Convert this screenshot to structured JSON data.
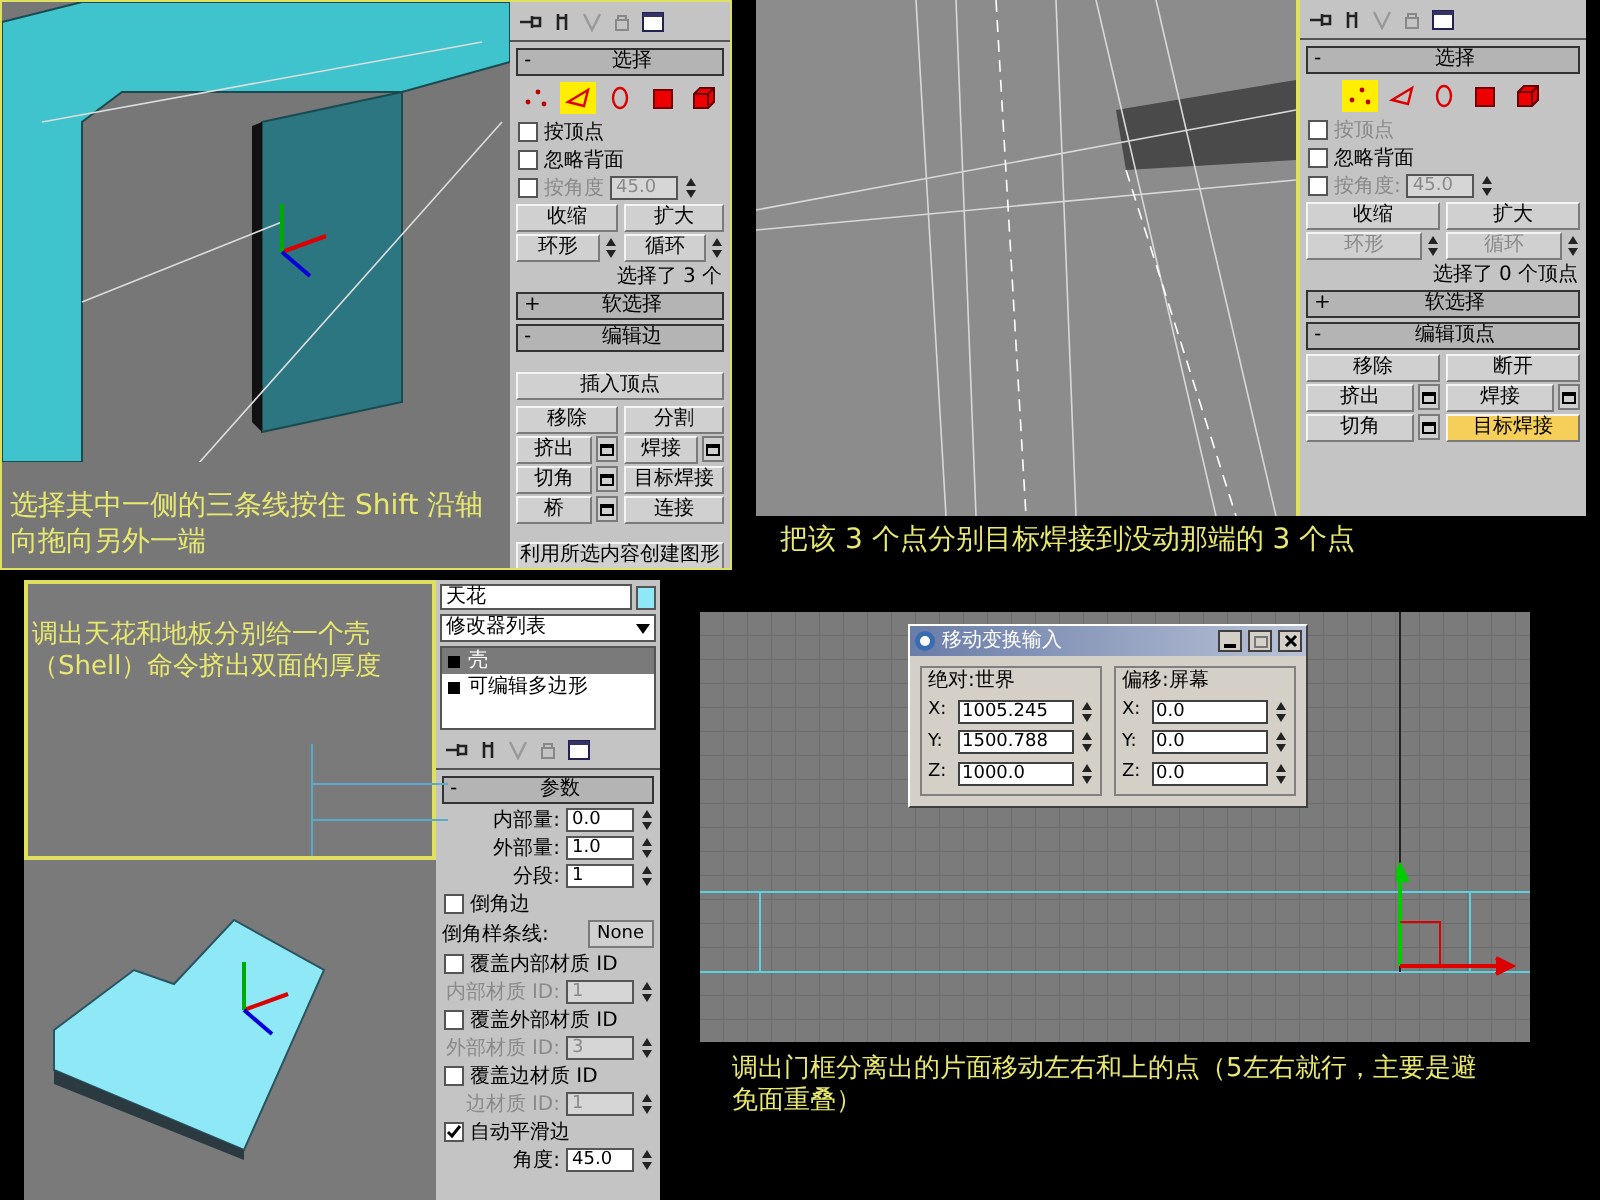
{
  "top_left": {
    "caption": "选择其中一侧的三条线按住 Shift 沿轴向拖向另外一端",
    "command_panel": {
      "rollouts": [
        {
          "toggle": "-",
          "title": "选择",
          "items": [
            {
              "kind": "modes",
              "modes": [
                {
                  "selected": false
                },
                {
                  "selected": true
                },
                {
                  "selected": false
                },
                {
                  "selected": false
                },
                {
                  "selected": false
                }
              ]
            },
            {
              "kind": "checkbox",
              "label": "按顶点",
              "checked": false,
              "disabled": false
            },
            {
              "kind": "checkbox",
              "label": "忽略背面",
              "checked": false,
              "disabled": false
            },
            {
              "kind": "angle",
              "label": "按角度",
              "value": "45.0",
              "checked": false,
              "disabled": true
            },
            {
              "kind": "buttons",
              "buttons": [
                {
                  "kind": "plain",
                  "label": "收缩",
                  "disabled": false,
                  "active": false
                },
                {
                  "kind": "plain",
                  "label": "扩大",
                  "disabled": false,
                  "active": false
                }
              ]
            },
            {
              "kind": "buttons",
              "buttons": [
                {
                  "kind": "spin",
                  "label": "环形",
                  "disabled": false,
                  "active": false
                },
                {
                  "kind": "spin",
                  "label": "循环",
                  "disabled": false,
                  "active": false
                }
              ]
            },
            {
              "kind": "status",
              "text": "选择了 3 个"
            }
          ]
        },
        {
          "toggle": "+",
          "title": "软选择"
        },
        {
          "toggle": "-",
          "title": "编辑边",
          "items": [
            {
              "kind": "wide",
              "label": "插入顶点"
            },
            {
              "kind": "buttons",
              "buttons": [
                {
                  "kind": "plain",
                  "label": "移除",
                  "disabled": false,
                  "active": false
                },
                {
                  "kind": "plain",
                  "label": "分割",
                  "disabled": false,
                  "active": false
                }
              ]
            },
            {
              "kind": "buttons",
              "buttons": [
                {
                  "kind": "settings",
                  "label": "挤出",
                  "disabled": false,
                  "active": false
                },
                {
                  "kind": "settings",
                  "label": "焊接",
                  "disabled": false,
                  "active": false
                }
              ]
            },
            {
              "kind": "buttons",
              "buttons": [
                {
                  "kind": "settings",
                  "label": "切角",
                  "disabled": false,
                  "active": false
                },
                {
                  "kind": "plain",
                  "label": "目标焊接",
                  "disabled": false,
                  "active": false
                }
              ]
            },
            {
              "kind": "buttons",
              "buttons": [
                {
                  "kind": "settings",
                  "label": "桥",
                  "disabled": false,
                  "active": false
                },
                {
                  "kind": "plain",
                  "label": "连接",
                  "disabled": false,
                  "active": false
                }
              ]
            },
            {
              "kind": "wide",
              "label": "利用所选内容创建图形"
            }
          ]
        }
      ]
    }
  },
  "top_right": {
    "caption": "把该 3 个点分别目标焊接到没动那端的 3 个点",
    "command_panel": {
      "rollouts": [
        {
          "toggle": "-",
          "title": "选择",
          "items": [
            {
              "kind": "modes",
              "modes": [
                {
                  "selected": true
                },
                {
                  "selected": false
                },
                {
                  "selected": false
                },
                {
                  "selected": false
                },
                {
                  "selected": false
                }
              ]
            },
            {
              "kind": "checkbox",
              "label": "按顶点",
              "checked": false,
              "disabled": true
            },
            {
              "kind": "checkbox",
              "label": "忽略背面",
              "checked": false,
              "disabled": false
            },
            {
              "kind": "angle",
              "label": "按角度:",
              "value": "45.0",
              "checked": false,
              "disabled": true
            },
            {
              "kind": "buttons",
              "buttons": [
                {
                  "kind": "plain",
                  "label": "收缩",
                  "disabled": false,
                  "active": false
                },
                {
                  "kind": "plain",
                  "label": "扩大",
                  "disabled": false,
                  "active": false
                }
              ]
            },
            {
              "kind": "buttons",
              "buttons": [
                {
                  "kind": "spin",
                  "label": "环形",
                  "disabled": true,
                  "active": false
                },
                {
                  "kind": "spin",
                  "label": "循环",
                  "disabled": true,
                  "active": false
                }
              ]
            },
            {
              "kind": "status",
              "text": "选择了 0 个顶点"
            }
          ]
        },
        {
          "toggle": "+",
          "title": "软选择"
        },
        {
          "toggle": "-",
          "title": "编辑顶点",
          "items": [
            {
              "kind": "buttons",
              "buttons": [
                {
                  "kind": "plain",
                  "label": "移除",
                  "disabled": false,
                  "active": false
                },
                {
                  "kind": "plain",
                  "label": "断开",
                  "disabled": false,
                  "active": false
                }
              ]
            },
            {
              "kind": "buttons",
              "buttons": [
                {
                  "kind": "settings",
                  "label": "挤出",
                  "disabled": false,
                  "active": false
                },
                {
                  "kind": "settings",
                  "label": "焊接",
                  "disabled": false,
                  "active": false
                }
              ]
            },
            {
              "kind": "buttons",
              "buttons": [
                {
                  "kind": "settings",
                  "label": "切角",
                  "disabled": false,
                  "active": false
                },
                {
                  "kind": "plain",
                  "label": "目标焊接",
                  "disabled": false,
                  "active": true
                }
              ]
            }
          ]
        }
      ]
    }
  },
  "bottom_left": {
    "caption": "调出天花和地板分别给一个壳（Shell）命令挤出双面的厚度",
    "object_name": "天花",
    "modifier_list": "修改器列表",
    "stack": [
      {
        "label": "壳",
        "selected": true
      },
      {
        "label": "可编辑多边形",
        "selected": false
      }
    ],
    "command_panel": {
      "rollouts": [
        {
          "toggle": "-",
          "title": "参数",
          "items": [
            {
              "kind": "spinner",
              "label": "内部量:",
              "value": "0.0",
              "disabled": false
            },
            {
              "kind": "spinner",
              "label": "外部量:",
              "value": "1.0",
              "disabled": false
            },
            {
              "kind": "spinner",
              "label": "分段:",
              "value": "1",
              "disabled": false
            },
            {
              "kind": "checkbox",
              "label": "倒角边",
              "checked": false,
              "disabled": false
            },
            {
              "kind": "picker",
              "label": "倒角样条线:",
              "value": "None"
            },
            {
              "kind": "checkbox",
              "label": "覆盖内部材质 ID",
              "checked": false,
              "disabled": false
            },
            {
              "kind": "spinner",
              "label": "内部材质 ID:",
              "value": "1",
              "disabled": true
            },
            {
              "kind": "checkbox",
              "label": "覆盖外部材质 ID",
              "checked": false,
              "disabled": false
            },
            {
              "kind": "spinner",
              "label": "外部材质 ID:",
              "value": "3",
              "disabled": true
            },
            {
              "kind": "checkbox",
              "label": "覆盖边材质 ID",
              "checked": false,
              "disabled": false
            },
            {
              "kind": "spinner",
              "label": "边材质 ID:",
              "value": "1",
              "disabled": true
            },
            {
              "kind": "checkbox",
              "label": "自动平滑边",
              "checked": true,
              "disabled": false
            },
            {
              "kind": "spinner",
              "label": "角度:",
              "value": "45.0",
              "disabled": false
            }
          ]
        }
      ]
    }
  },
  "bottom_right": {
    "caption": "调出门框分离出的片面移动左右和上的点（5左右就行，主要是避免面重叠）",
    "dialog": {
      "title": "移动变换输入",
      "groups": [
        {
          "title": "绝对:世界",
          "fields": [
            {
              "axis": "X:",
              "value": "1005.245"
            },
            {
              "axis": "Y:",
              "value": "1500.788"
            },
            {
              "axis": "Z:",
              "value": "1000.0"
            }
          ]
        },
        {
          "title": "偏移:屏幕",
          "fields": [
            {
              "axis": "X:",
              "value": "0.0"
            },
            {
              "axis": "Y:",
              "value": "0.0"
            },
            {
              "axis": "Z:",
              "value": "0.0"
            }
          ]
        }
      ]
    }
  }
}
